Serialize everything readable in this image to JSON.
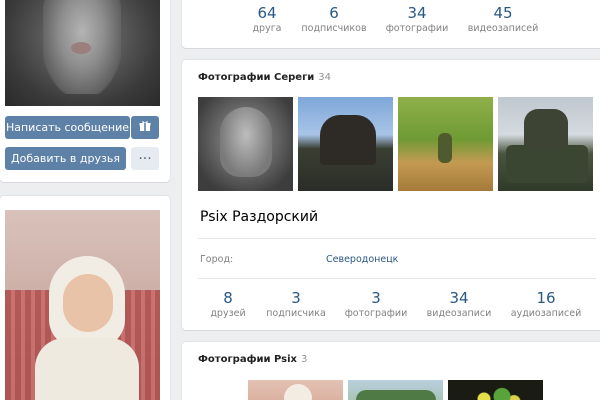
{
  "left": {
    "message_button": "Написать сообщение",
    "add_friend_button": "Добавить в друзья",
    "more_button": "···"
  },
  "top_counters": [
    {
      "num": "64",
      "label": "друга"
    },
    {
      "num": "6",
      "label": "подписчиков"
    },
    {
      "num": "34",
      "label": "фотографии"
    },
    {
      "num": "45",
      "label": "видеозаписей"
    }
  ],
  "photos_sergey": {
    "title": "Фотографии Сереги",
    "count": "34"
  },
  "profile": {
    "name": "Psix Раздорский",
    "city_label": "Город:",
    "city_value": "Северодонецк"
  },
  "bottom_counters": [
    {
      "num": "8",
      "label": "друзей"
    },
    {
      "num": "3",
      "label": "подписчика"
    },
    {
      "num": "3",
      "label": "фотографии"
    },
    {
      "num": "34",
      "label": "видеозаписи"
    },
    {
      "num": "16",
      "label": "аудиозаписей"
    }
  ],
  "photos_psix": {
    "title": "Фотографии Psix",
    "count": "3"
  },
  "colors": {
    "accent": "#5e81a8",
    "link": "#2a5885",
    "muted": "#828282",
    "background": "#edeef0"
  },
  "icons": [
    "gift-icon",
    "more-dots-icon"
  ]
}
